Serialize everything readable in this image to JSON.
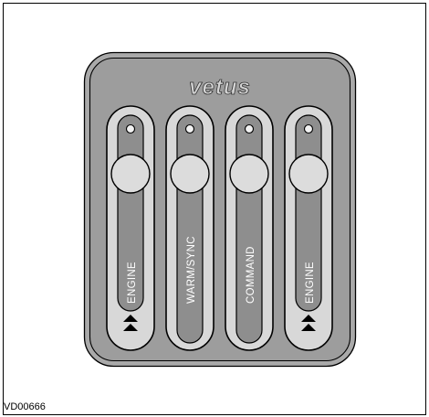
{
  "brand": "vetus",
  "drawing_code": "VD00666",
  "panel": {
    "base_color": "#9d9d9d",
    "slot_color": "#d8d8d8",
    "knob_color": "#dcdcdc",
    "buttons": [
      {
        "label": "ENGINE",
        "has_arrows": true,
        "icon": "double-up-arrow-icon"
      },
      {
        "label": "WARM/SYNC",
        "has_arrows": false
      },
      {
        "label": "COMMAND",
        "has_arrows": false
      },
      {
        "label": "ENGINE",
        "has_arrows": true,
        "icon": "double-up-arrow-icon"
      }
    ]
  }
}
